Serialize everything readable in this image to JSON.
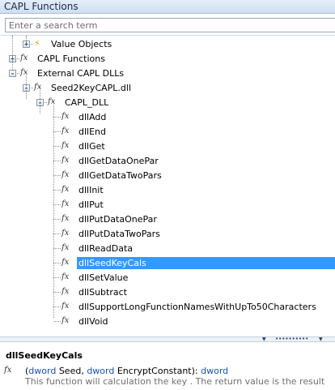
{
  "window": {
    "title": "CAPL Functions"
  },
  "search": {
    "placeholder": "Enter a search term"
  },
  "tree": [
    {
      "label": "Value Objects",
      "icon": "lightning-icon",
      "expander": "+",
      "depth": 1
    },
    {
      "label": "CAPL Functions",
      "icon": "function-icon",
      "expander": "+",
      "depth": 0
    },
    {
      "label": "External CAPL DLLs",
      "icon": "function-icon",
      "expander": "-",
      "depth": 0
    },
    {
      "label": "Seed2KeyCAPL.dll",
      "icon": "function-icon",
      "expander": "-",
      "depth": 1
    },
    {
      "label": "CAPL_DLL",
      "icon": "function-icon",
      "expander": "-",
      "depth": 2
    },
    {
      "label": "dllAdd",
      "icon": "function-icon",
      "depth": 3
    },
    {
      "label": "dllEnd",
      "icon": "function-icon",
      "depth": 3
    },
    {
      "label": "dllGet",
      "icon": "function-icon",
      "depth": 3
    },
    {
      "label": "dllGetDataOnePar",
      "icon": "function-icon",
      "depth": 3
    },
    {
      "label": "dllGetDataTwoPars",
      "icon": "function-icon",
      "depth": 3
    },
    {
      "label": "dllInit",
      "icon": "function-icon",
      "depth": 3
    },
    {
      "label": "dllPut",
      "icon": "function-icon",
      "depth": 3
    },
    {
      "label": "dllPutDataOnePar",
      "icon": "function-icon",
      "depth": 3
    },
    {
      "label": "dllPutDataTwoPars",
      "icon": "function-icon",
      "depth": 3
    },
    {
      "label": "dllReadData",
      "icon": "function-icon",
      "depth": 3
    },
    {
      "label": "dllSeedKeyCals",
      "icon": "function-icon",
      "depth": 3,
      "selected": true
    },
    {
      "label": "dllSetValue",
      "icon": "function-icon",
      "depth": 3
    },
    {
      "label": "dllSubtract",
      "icon": "function-icon",
      "depth": 3
    },
    {
      "label": "dllSupportLongFunctionNamesWithUpTo50Characters",
      "icon": "function-icon",
      "depth": 3
    },
    {
      "label": "dllVoid",
      "icon": "function-icon",
      "depth": 3
    }
  ],
  "info": {
    "function_name": "dllSeedKeyCals",
    "fx_symbol": "fx",
    "signature": {
      "open": "(",
      "type1": "dword",
      "param1": " Seed, ",
      "type2": "dword",
      "param2": " EncryptConstant): ",
      "return_type": "dword"
    },
    "description": "This function will calculation the key . The return value is the result"
  },
  "colors": {
    "selection": "#3399ff",
    "keyword": "#1b4fb5",
    "description": "#707070",
    "title_bar": "#dce8f6"
  }
}
